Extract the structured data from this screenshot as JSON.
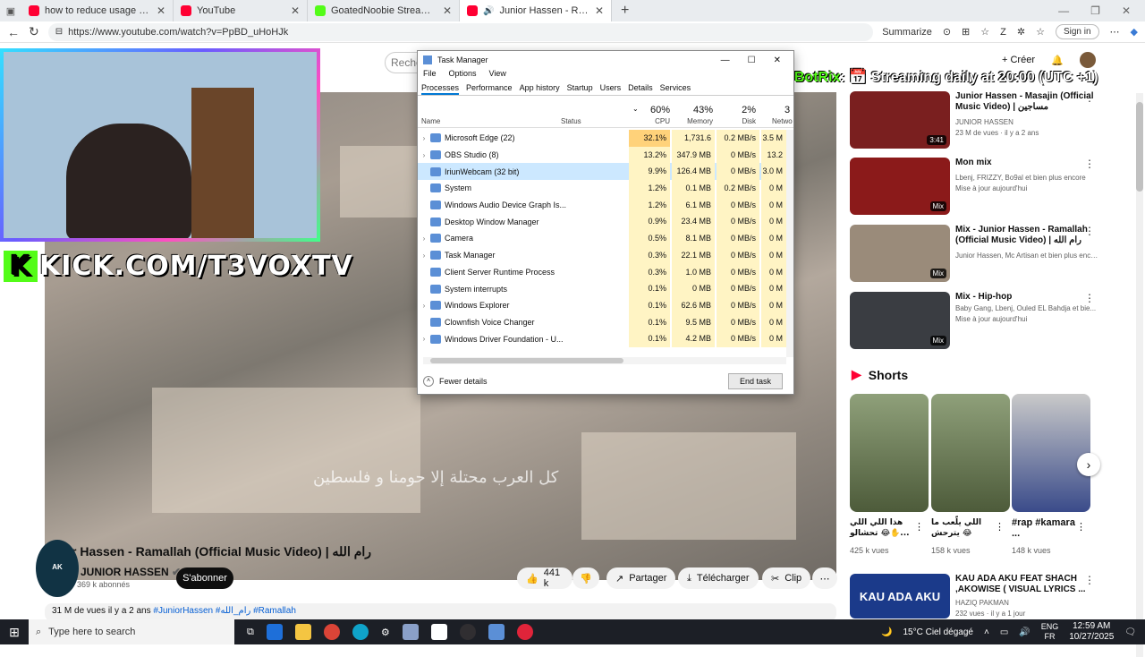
{
  "browser": {
    "tabs": [
      {
        "title": "how to reduce usage of app in pc",
        "color": "#ff0033"
      },
      {
        "title": "YouTube",
        "color": "#ff0033"
      },
      {
        "title": "GoatedNoobie Stream - Watch Liv",
        "color": "#53fc18"
      },
      {
        "title": "Junior Hassen - Ramallah (O",
        "color": "#ff0033"
      }
    ],
    "url": "https://www.youtube.com/watch?v=PpBD_uHoHJk",
    "summarize_label": "Summarize",
    "signin_label": "Sign in"
  },
  "youtube": {
    "search_placeholder": "Recher",
    "create_label": "Créer",
    "video_title": "r Hassen - Ramallah (Official Music Video) | رام الله",
    "subtitle_text": "كل العرب محتلة إلا حومنا و فلسطين",
    "channel_name": "JUNIOR HASSEN",
    "avatar_text": "AK",
    "subscribers": "369 k abonnés",
    "subscribe_label": "S'abonner",
    "likes": "441 k",
    "share_label": "Partager",
    "download_label": "Télécharger",
    "clip_label": "Clip",
    "description_stats": "31 M de vues  il y a 2 ans",
    "description_tags": "#JuniorHassen #رام_الله #Ramallah"
  },
  "overlay": {
    "kick_letter": "K",
    "kick_text": "KICK.COM/T3VOXTV",
    "botrix_name": "BotRix",
    "botrix_text": ": 📅 Streaming daily at 20:00 (UTC +1)"
  },
  "recommendations": [
    {
      "title": "Junior Hassen - Masajin (Official Music Video) | مساجين",
      "channel": "JUNIOR HASSEN",
      "meta": "23 M de vues · il y a 2 ans",
      "badge": "3:41",
      "color": "#7a1f1f"
    },
    {
      "title": "Mon mix",
      "channel": "Lbenj, FRIZZY, Bo9al et bien plus encore",
      "meta": "Mise à jour aujourd'hui",
      "badge": "Mix",
      "color": "#8b1a1a"
    },
    {
      "title": "Mix - Junior Hassen - Ramallah (Official Music Video) | رام الله",
      "channel": "Junior Hassen, Mc Artisan et bien plus encore",
      "meta": "",
      "badge": "Mix",
      "color": "#9a8b7a"
    },
    {
      "title": "Mix - Hip-hop",
      "channel": "Baby Gang, Lbenj, Ouled EL Bahdja et bie...",
      "meta": "Mise à jour aujourd'hui",
      "badge": "Mix",
      "color": "#3a3d42"
    }
  ],
  "shorts": {
    "heading": "Shorts",
    "items": [
      {
        "title": "هذا اللي اللي تحشالو 😂✋...",
        "views": "425 k vues"
      },
      {
        "title": "اللي يلّعب ما يترحش 😂",
        "views": "158 k vues"
      },
      {
        "title": "#rap #kamara ...",
        "views": "148 k vues"
      }
    ]
  },
  "last_recommendation": {
    "title": "KAU ADA AKU FEAT SHACH ,AKOWISE ( VISUAL LYRICS ...",
    "channel": "HAZIQ PAKMAN",
    "meta": "232 vues · il y a 1 jour",
    "thumb_text": "KAU ADA AKU"
  },
  "task_manager": {
    "title": "Task Manager",
    "menu": [
      "File",
      "Options",
      "View"
    ],
    "tabs": [
      "Processes",
      "Performance",
      "App history",
      "Startup",
      "Users",
      "Details",
      "Services"
    ],
    "columns": {
      "name": "Name",
      "status": "Status",
      "cpu_pct": "60%",
      "cpu": "CPU",
      "mem_pct": "43%",
      "mem": "Memory",
      "disk_pct": "2%",
      "disk": "Disk",
      "net_pct": "3",
      "net": "Netwo"
    },
    "processes": [
      {
        "name": "Microsoft Edge (22)",
        "cpu": "32.1%",
        "mem": "1,731.6 MB",
        "disk": "0.2 MB/s",
        "net": "3.5 M",
        "expand": true
      },
      {
        "name": "OBS Studio (8)",
        "cpu": "13.2%",
        "mem": "347.9 MB",
        "disk": "0 MB/s",
        "net": "13.2 M",
        "expand": true
      },
      {
        "name": "IriunWebcam (32 bit)",
        "cpu": "9.9%",
        "mem": "126.4 MB",
        "disk": "0 MB/s",
        "net": "3.0 M",
        "expand": false,
        "selected": true
      },
      {
        "name": "System",
        "cpu": "1.2%",
        "mem": "0.1 MB",
        "disk": "0.2 MB/s",
        "net": "0 M",
        "expand": false
      },
      {
        "name": "Windows Audio Device Graph Is...",
        "cpu": "1.2%",
        "mem": "6.1 MB",
        "disk": "0 MB/s",
        "net": "0 M",
        "expand": false
      },
      {
        "name": "Desktop Window Manager",
        "cpu": "0.9%",
        "mem": "23.4 MB",
        "disk": "0 MB/s",
        "net": "0 M",
        "expand": false
      },
      {
        "name": "Camera",
        "cpu": "0.5%",
        "mem": "8.1 MB",
        "disk": "0 MB/s",
        "net": "0 M",
        "expand": true
      },
      {
        "name": "Task Manager",
        "cpu": "0.3%",
        "mem": "22.1 MB",
        "disk": "0 MB/s",
        "net": "0 M",
        "expand": true
      },
      {
        "name": "Client Server Runtime Process",
        "cpu": "0.3%",
        "mem": "1.0 MB",
        "disk": "0 MB/s",
        "net": "0 M",
        "expand": false
      },
      {
        "name": "System interrupts",
        "cpu": "0.1%",
        "mem": "0 MB",
        "disk": "0 MB/s",
        "net": "0 M",
        "expand": false
      },
      {
        "name": "Windows Explorer",
        "cpu": "0.1%",
        "mem": "62.6 MB",
        "disk": "0 MB/s",
        "net": "0 M",
        "expand": true
      },
      {
        "name": "Clownfish Voice Changer",
        "cpu": "0.1%",
        "mem": "9.5 MB",
        "disk": "0 MB/s",
        "net": "0 M",
        "expand": false
      },
      {
        "name": "Windows Driver Foundation - U...",
        "cpu": "0.1%",
        "mem": "4.2 MB",
        "disk": "0 MB/s",
        "net": "0 M",
        "expand": true
      }
    ],
    "fewer_details": "Fewer details",
    "end_task": "End task"
  },
  "taskbar": {
    "search_placeholder": "Type here to search",
    "weather": "15°C  Ciel dégagé",
    "lang_top": "ENG",
    "lang_bottom": "FR",
    "time": "12:59 AM",
    "date": "10/27/2025"
  }
}
